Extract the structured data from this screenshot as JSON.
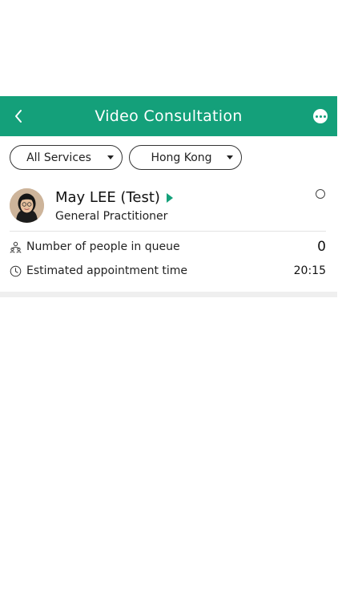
{
  "header": {
    "title": "Video Consultation",
    "back_icon": "chevron-left-icon",
    "more_icon": "more-horizontal-icon"
  },
  "filters": {
    "service": "All Services",
    "region": "Hong Kong"
  },
  "doctor": {
    "name": "May LEE (Test)",
    "title": "General Practitioner"
  },
  "queue": {
    "label": "Number of people in queue",
    "value": "0"
  },
  "appointment": {
    "label": "Estimated appointment time",
    "value": "20:15"
  },
  "colors": {
    "brand": "#14a07a",
    "background": "#ffffff",
    "band": "#efefef"
  }
}
